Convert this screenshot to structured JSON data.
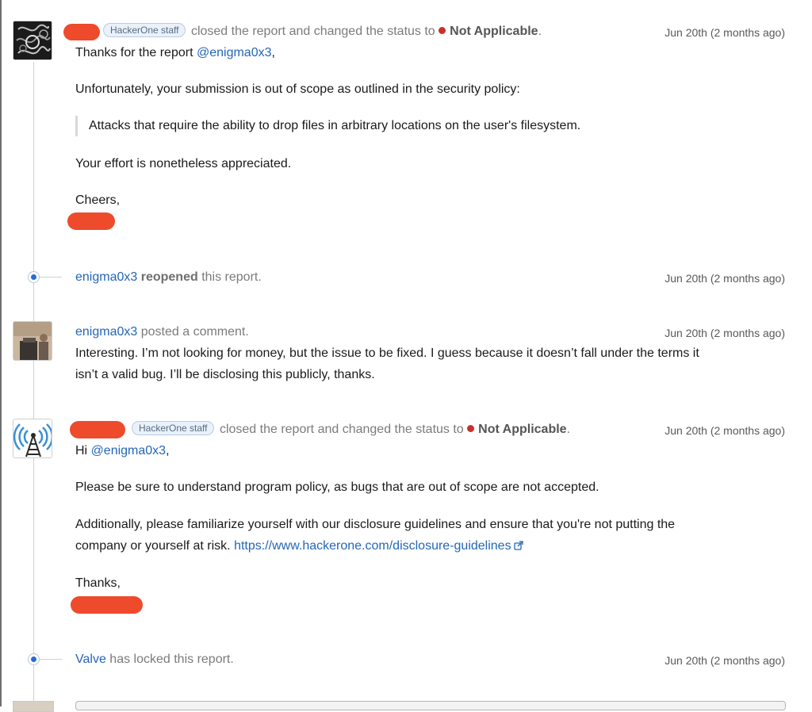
{
  "comment1": {
    "avatar_icon": "dark-pattern-avatar-icon",
    "staff_badge": "HackerOne staff",
    "action": "closed the report and changed the status to",
    "status": "Not Applicable",
    "status_suffix": ".",
    "date": "Jun 20th (2 months ago)",
    "greeting": "Thanks for the report",
    "mention": "@enigma0x3",
    "greeting_suffix": ",",
    "paragraph": "Unfortunately, your submission is out of scope as outlined in the security policy:",
    "quote": "Attacks that require the ability to drop files in arbitrary locations on the user's filesystem.",
    "paragraph2": "Your effort is nonetheless appreciated.",
    "signoff": "Cheers,"
  },
  "event1": {
    "actor": "enigma0x3",
    "verb": "reopened",
    "rest": "this report.",
    "date": "Jun 20th (2 months ago)"
  },
  "comment2": {
    "avatar_icon": "user-photo-avatar-icon",
    "author": "enigma0x3",
    "action": "posted a comment.",
    "date": "Jun 20th (2 months ago)",
    "line1": "Interesting. I’m not looking for money, but the issue to be fixed. I guess because it doesn’t fall under the terms it",
    "line2": "isn’t a valid bug. I’ll be disclosing this publicly, thanks."
  },
  "comment3": {
    "avatar_icon": "radio-tower-avatar-icon",
    "staff_badge": "HackerOne staff",
    "action": "closed the report and changed the status to",
    "status": "Not Applicable",
    "status_suffix": ".",
    "date": "Jun 20th (2 months ago)",
    "greeting": "Hi",
    "mention": "@enigma0x3",
    "greeting_suffix": ",",
    "paragraph": "Please be sure to understand program policy, as bugs that are out of scope are not accepted.",
    "paragraph2_line1": "Additionally, please familiarize yourself with our disclosure guidelines and ensure that you're not putting the",
    "paragraph2_line2": "company or yourself at risk.",
    "link": "https://www.hackerone.com/disclosure-guidelines",
    "signoff": "Thanks,"
  },
  "event2": {
    "actor": "Valve",
    "rest": "has locked this report.",
    "date": "Jun 20th (2 months ago)"
  },
  "colors": {
    "link": "#2466b8",
    "redaction": "#ee4a2c",
    "status_dot": "#c9302c",
    "timeline_dot": "#2a6bd3"
  }
}
